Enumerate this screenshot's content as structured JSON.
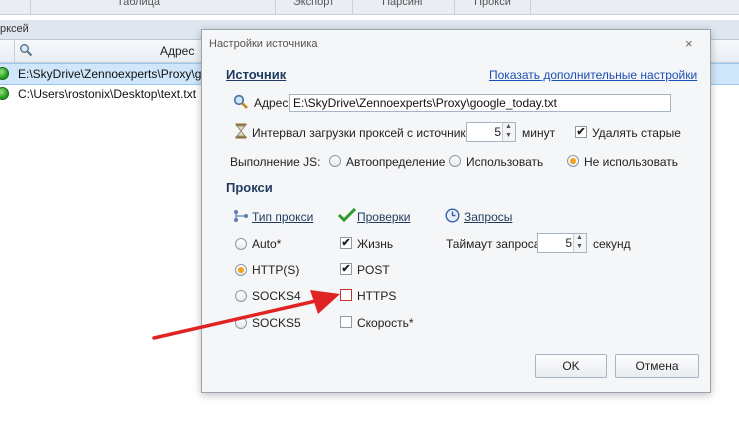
{
  "top_tabs": [
    "Таблица",
    "Экспорт",
    "Парсинг",
    "Прокси"
  ],
  "section": {
    "label": "рксей"
  },
  "grid": {
    "header": "Адрес",
    "rows": [
      {
        "text": "E:\\SkyDrive\\Zennoexperts\\Proxy\\goog",
        "selected": true
      },
      {
        "text": "C:\\Users\\rostonix\\Desktop\\text.txt",
        "selected": false
      }
    ]
  },
  "dialog": {
    "title": "Настройки источника",
    "close": "×",
    "source": {
      "heading": "Источник",
      "more_link": "Показать дополнительные настройки",
      "address_label": "Адрес",
      "address_value": "E:\\SkyDrive\\Zennoexperts\\Proxy\\google_today.txt",
      "interval_label": "Интервал загрузки проксей с источника:",
      "interval_value": "5",
      "interval_unit": "минут",
      "delete_old_label": "Удалять старые",
      "delete_old_checked": true,
      "js_label": "Выполнение JS:",
      "js_options": [
        "Автоопределение",
        "Использовать",
        "Не использовать"
      ],
      "js_selected": 2
    },
    "proxy": {
      "heading": "Прокси",
      "type_link": "Тип прокси",
      "checks_link": "Проверки",
      "requests_link": "Запросы",
      "types": [
        "Auto*",
        "HTTP(S)",
        "SOCKS4",
        "SOCKS5"
      ],
      "type_selected": 1,
      "checks": [
        {
          "label": "Жизнь",
          "checked": true
        },
        {
          "label": "POST",
          "checked": true
        },
        {
          "label": "HTTPS",
          "checked": false
        },
        {
          "label": "Скорость*",
          "checked": false
        }
      ],
      "timeout_label": "Таймаут запроса",
      "timeout_value": "5",
      "timeout_unit": "секунд"
    },
    "ok": "OK",
    "cancel": "Отмена"
  },
  "colors": {
    "accent": "#1a4fb5",
    "arrow": "#e02424",
    "selected_row": "#cfe6fb"
  }
}
